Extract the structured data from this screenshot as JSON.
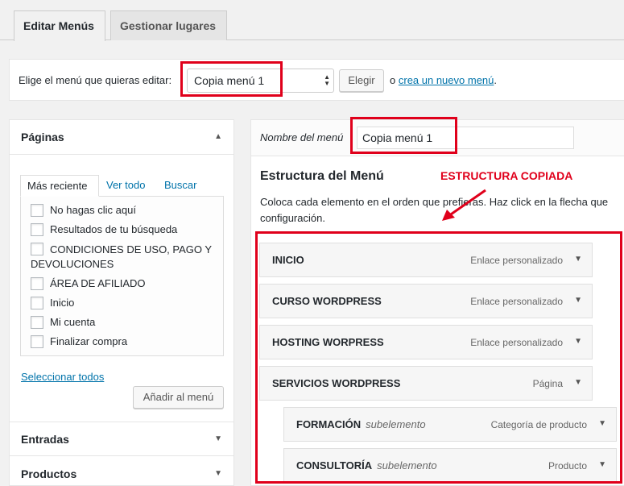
{
  "tabs": {
    "edit": "Editar Menús",
    "manage": "Gestionar lugares"
  },
  "select_bar": {
    "label": "Elige el menú que quieras editar:",
    "selected": "Copia menú 1",
    "choose_button": "Elegir",
    "or": "o",
    "create_link": "crea un nuevo menú",
    "dot": "."
  },
  "pages_panel": {
    "title": "Páginas",
    "tabs": [
      "Más reciente",
      "Ver todo",
      "Buscar"
    ],
    "items": [
      "No hagas clic aquí",
      "Resultados de tu búsqueda",
      "CONDICIONES DE USO, PAGO Y DEVOLUCIONES",
      "ÁREA DE AFILIADO",
      "Inicio",
      "Mi cuenta",
      "Finalizar compra"
    ],
    "select_all": "Seleccionar todos",
    "add_button": "Añadir al menú"
  },
  "other_panels": [
    "Entradas",
    "Productos"
  ],
  "menu_editor": {
    "name_label": "Nombre del menú",
    "name_value": "Copia menú 1",
    "structure_title": "Estructura del Menú",
    "annotation": "ESTRUCTURA COPIADA",
    "description_line1": "Coloca cada elemento en el orden que prefieras. Haz click en la flecha que",
    "description_line2": "configuración.",
    "items": [
      {
        "title": "INICIO",
        "sub": "",
        "type": "Enlace personalizado"
      },
      {
        "title": "CURSO WORDPRESS",
        "sub": "",
        "type": "Enlace personalizado"
      },
      {
        "title": "HOSTING WORPRESS",
        "sub": "",
        "type": "Enlace personalizado"
      },
      {
        "title": "SERVICIOS WORDPRESS",
        "sub": "",
        "type": "Página"
      },
      {
        "title": "FORMACIÓN",
        "sub": "subelemento",
        "type": "Categoría de producto"
      },
      {
        "title": "CONSULTORÍA",
        "sub": "subelemento",
        "type": "Producto"
      }
    ]
  },
  "colors": {
    "highlight": "#e0001b",
    "link": "#0073aa"
  },
  "icons": {
    "collapse": "triangle-up-icon",
    "expand": "triangle-down-icon"
  }
}
